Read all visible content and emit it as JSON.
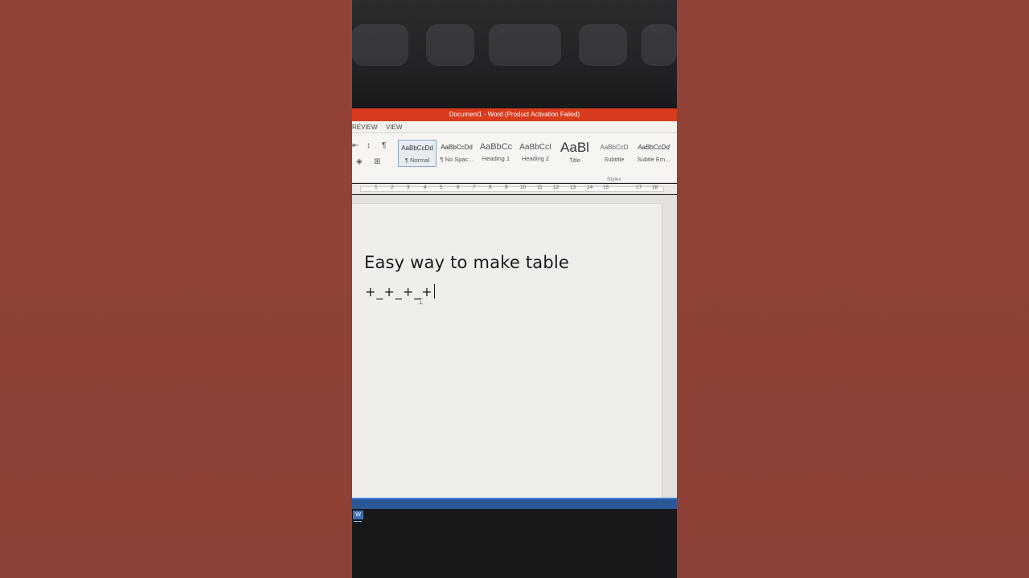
{
  "window": {
    "title": "Document1 - Word (Product Activation Failed)"
  },
  "ribbon_tabs": [
    "REVIEW",
    "VIEW"
  ],
  "styles_gallery": {
    "group_label": "Styles",
    "items": [
      {
        "preview": "AaBbCcDd",
        "name": "¶ Normal",
        "selected": true
      },
      {
        "preview": "AaBbCcDd",
        "name": "¶ No Spac..."
      },
      {
        "preview": "AaBbCc",
        "name": "Heading 1"
      },
      {
        "preview": "AaBbCcI",
        "name": "Heading 2"
      },
      {
        "preview": "AaBl",
        "name": "Title"
      },
      {
        "preview": "AaBbCcD",
        "name": "Subtitle"
      },
      {
        "preview": "AaBbCcDd",
        "name": "Subtle Em..."
      }
    ]
  },
  "ruler": {
    "marks": [
      "1",
      "2",
      "3",
      "4",
      "5",
      "6",
      "7",
      "8",
      "9",
      "10",
      "11",
      "12",
      "13",
      "14",
      "15",
      "17",
      "18"
    ]
  },
  "document": {
    "heading": "Easy way to make table",
    "line": "+_+_+_+"
  },
  "colors": {
    "titlebar": "#d83b1e",
    "statusbar": "#2b5797",
    "background": "#8f4236"
  }
}
